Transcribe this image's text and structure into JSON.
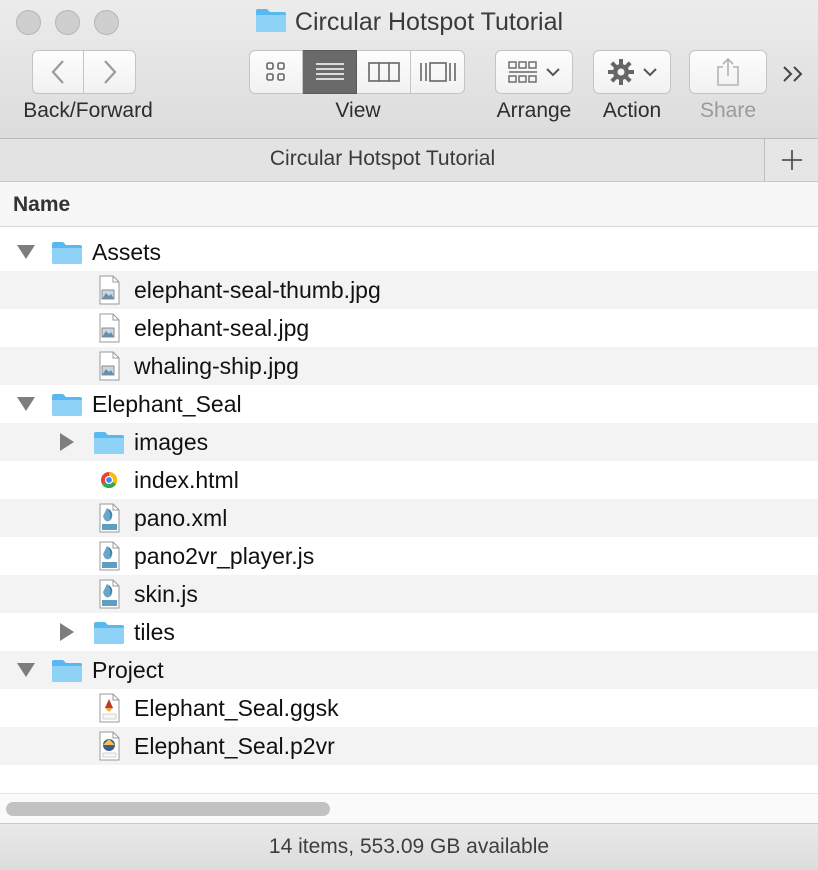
{
  "window": {
    "title": "Circular Hotspot Tutorial"
  },
  "toolbar": {
    "nav_label": "Back/Forward",
    "view_label": "View",
    "arrange_label": "Arrange",
    "action_label": "Action",
    "share_label": "Share",
    "more_glyph": "»›",
    "back_glyph": "‹",
    "forward_glyph": "›"
  },
  "pathbar": {
    "title": "Circular Hotspot Tutorial",
    "add_glyph": "+"
  },
  "columns": {
    "name": "Name"
  },
  "files": [
    {
      "label": "Assets",
      "kind": "folder",
      "level": 0,
      "disclosure": "open"
    },
    {
      "label": "elephant-seal-thumb.jpg",
      "kind": "image",
      "level": 1,
      "disclosure": "none"
    },
    {
      "label": "elephant-seal.jpg",
      "kind": "image",
      "level": 1,
      "disclosure": "none"
    },
    {
      "label": "whaling-ship.jpg",
      "kind": "image",
      "level": 1,
      "disclosure": "none"
    },
    {
      "label": "Elephant_Seal",
      "kind": "folder",
      "level": 0,
      "disclosure": "open"
    },
    {
      "label": "images",
      "kind": "folder",
      "level": 1,
      "disclosure": "closed"
    },
    {
      "label": "index.html",
      "kind": "html",
      "level": 1,
      "disclosure": "none"
    },
    {
      "label": "pano.xml",
      "kind": "text",
      "level": 1,
      "disclosure": "none"
    },
    {
      "label": "pano2vr_player.js",
      "kind": "text",
      "level": 1,
      "disclosure": "none"
    },
    {
      "label": "skin.js",
      "kind": "text",
      "level": 1,
      "disclosure": "none"
    },
    {
      "label": "tiles",
      "kind": "folder",
      "level": 1,
      "disclosure": "closed"
    },
    {
      "label": "Project",
      "kind": "folder",
      "level": 0,
      "disclosure": "open"
    },
    {
      "label": "Elephant_Seal.ggsk",
      "kind": "ggsk",
      "level": 1,
      "disclosure": "none"
    },
    {
      "label": "Elephant_Seal.p2vr",
      "kind": "p2vr",
      "level": 1,
      "disclosure": "none"
    }
  ],
  "status": {
    "text": "14 items, 553.09 GB available"
  },
  "colors": {
    "folder": "#5ab8f0",
    "accent_active": "#6a6a6a"
  }
}
